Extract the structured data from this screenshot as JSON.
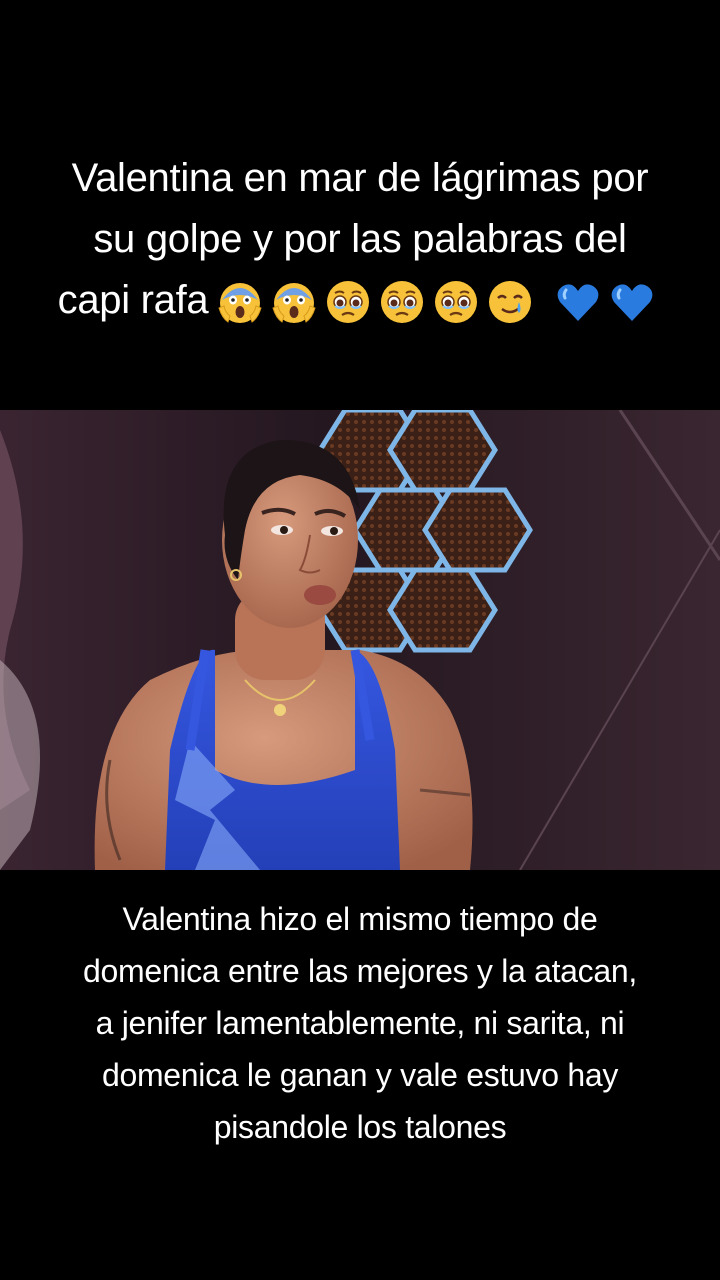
{
  "top_caption": {
    "line1": "Valentina en mar de lágrimas por",
    "line2": "su golpe y por las palabras del",
    "line3": "capi rafa",
    "emojis": [
      "face-screaming-in-fear-icon",
      "face-screaming-in-fear-icon",
      "face-holding-back-tears-icon",
      "face-holding-back-tears-icon",
      "face-holding-back-tears-icon",
      "smiling-face-with-tear-icon",
      "blue-heart-icon",
      "blue-heart-icon"
    ]
  },
  "video": {
    "subject": "woman in blue sports top in front of hexagon-lit set"
  },
  "bottom_caption": {
    "line1": "Valentina hizo el mismo tiempo de",
    "line2": "domenica entre las mejores y la atacan,",
    "line3": "a jenifer lamentablemente, ni sarita, ni",
    "line4": "domenica le ganan y vale estuvo hay",
    "line5": "pisandole los talones"
  },
  "colors": {
    "background": "#000000",
    "text": "#ffffff",
    "shirt_blue": "#2f4fd6",
    "hex_glow": "#7fb6e8"
  }
}
